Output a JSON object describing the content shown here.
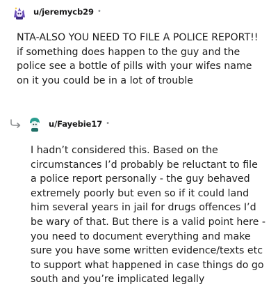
{
  "comments": [
    {
      "username": "u/jeremycb29",
      "separator": "•",
      "avatar_icon": "snoo-avatar-icon",
      "body": "NTA-ALSO YOU NEED TO FILE A POLICE REPORT!! if something does happen to the guy and the police see a bottle of pills with your wifes name on it you could be in a lot of trouble"
    },
    {
      "username": "u/Fayebie17",
      "separator": "•",
      "avatar_icon": "snoo-avatar-icon",
      "reply_icon": "reply-arrow-icon",
      "body": "I hadn’t considered this. Based on the circumstances I’d probably be reluctant to file a police report personally - the guy behaved extremely poorly but even so if it could land him several years in jail for drugs offences I’d be wary of that. But there is a valid point here - you need to document everything and make sure you have some written evidence/texts etc to support what happened in case things do go south and you’re implicated legally"
    }
  ],
  "colors": {
    "text": "#1c1c1c",
    "meta": "#878a8c",
    "background": "#ffffff"
  }
}
